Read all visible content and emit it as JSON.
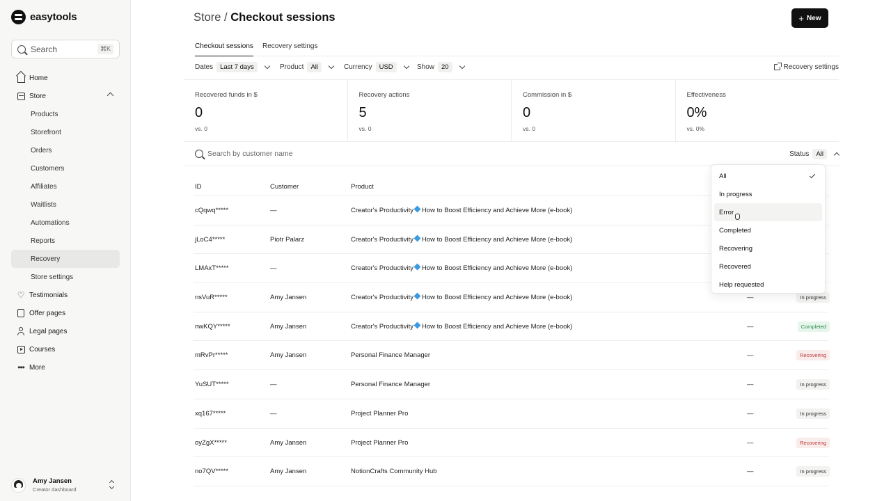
{
  "app": {
    "logo_text": "easytools"
  },
  "sidebar": {
    "search_label": "Search",
    "search_shortcut": "⌘K",
    "items": [
      {
        "label": "Home",
        "icon": "home-icon"
      },
      {
        "label": "Store",
        "icon": "store-icon",
        "expanded": true
      },
      {
        "label": "Products",
        "sub": true
      },
      {
        "label": "Storefront",
        "sub": true
      },
      {
        "label": "Orders",
        "sub": true
      },
      {
        "label": "Customers",
        "sub": true
      },
      {
        "label": "Affiliates",
        "sub": true
      },
      {
        "label": "Waitlists",
        "sub": true
      },
      {
        "label": "Automations",
        "sub": true
      },
      {
        "label": "Reports",
        "sub": true
      },
      {
        "label": "Recovery",
        "sub": true,
        "active": true
      },
      {
        "label": "Store settings",
        "sub": true
      },
      {
        "label": "Testimonials",
        "icon": "heart-icon"
      },
      {
        "label": "Offer pages",
        "icon": "page-icon"
      },
      {
        "label": "Legal pages",
        "icon": "user-icon"
      },
      {
        "label": "Courses",
        "icon": "play-icon"
      },
      {
        "label": "More",
        "icon": "more-icon"
      }
    ],
    "profile": {
      "name": "Amy Jansen",
      "subtitle": "Creator dashboard"
    }
  },
  "header": {
    "crumb": "Store",
    "separator": " / ",
    "title": "Checkout sessions",
    "new_button": "New"
  },
  "tabs": [
    {
      "label": "Checkout sessions",
      "active": true
    },
    {
      "label": "Recovery settings",
      "active": false
    }
  ],
  "filters": {
    "dates_label": "Dates",
    "dates_value": "Last 7 days",
    "product_label": "Product",
    "product_value": "All",
    "currency_label": "Currency",
    "currency_value": "USD",
    "show_label": "Show",
    "show_value": "20",
    "recovery_link": "Recovery settings"
  },
  "stats": [
    {
      "label": "Recovered funds in $",
      "value": "0",
      "sub": "vs. 0"
    },
    {
      "label": "Recovery actions",
      "value": "5",
      "sub": "vs. 0"
    },
    {
      "label": "Commission in $",
      "value": "0",
      "sub": "vs. 0"
    },
    {
      "label": "Effectiveness",
      "value": "0%",
      "sub": "vs. 0%"
    }
  ],
  "table_search": {
    "placeholder": "Search by customer name"
  },
  "status_filter": {
    "label": "Status",
    "value": "All"
  },
  "table": {
    "columns": [
      "ID",
      "Customer",
      "Product"
    ],
    "rows": [
      {
        "id": "cQqwq*****",
        "customer": "—",
        "product_a": "Creator's Productivity",
        "product_b": "How to Boost Efficiency and Achieve More (e-book)",
        "dash": "",
        "status": ""
      },
      {
        "id": "jLoC4*****",
        "customer": "Piotr Palarz",
        "product_a": "Creator's Productivity",
        "product_b": "How to Boost Efficiency and Achieve More (e-book)",
        "dash": "",
        "status": ""
      },
      {
        "id": "LMAxT*****",
        "customer": "—",
        "product_a": "Creator's Productivity",
        "product_b": "How to Boost Efficiency and Achieve More (e-book)",
        "dash": "",
        "status": ""
      },
      {
        "id": "nsVuR*****",
        "customer": "Amy Jansen",
        "product_a": "Creator's Productivity",
        "product_b": "How to Boost Efficiency and Achieve More (e-book)",
        "dash": "—",
        "status": "In progress"
      },
      {
        "id": "nwKQY*****",
        "customer": "Amy Jansen",
        "product_a": "Creator's Productivity",
        "product_b": "How to Boost Efficiency and Achieve More (e-book)",
        "dash": "—",
        "status": "Completed"
      },
      {
        "id": "mRvPr*****",
        "customer": "Amy Jansen",
        "product_a": "Personal Finance Manager",
        "product_b": "",
        "dash": "—",
        "status": "Recovering"
      },
      {
        "id": "YuSUT*****",
        "customer": "—",
        "product_a": "Personal Finance Manager",
        "product_b": "",
        "dash": "—",
        "status": "In progress"
      },
      {
        "id": "xq167*****",
        "customer": "—",
        "product_a": "Project Planner Pro",
        "product_b": "",
        "dash": "—",
        "status": "In progress"
      },
      {
        "id": "oyZgX*****",
        "customer": "Amy Jansen",
        "product_a": "Project Planner Pro",
        "product_b": "",
        "dash": "—",
        "status": "Recovering"
      },
      {
        "id": "no7QV*****",
        "customer": "Amy Jansen",
        "product_a": "NotionCrafts Community Hub",
        "product_b": "",
        "dash": "—",
        "status": "In progress"
      }
    ]
  },
  "status_dropdown": {
    "options": [
      "All",
      "In progress",
      "Error",
      "Completed",
      "Recovering",
      "Recovered",
      "Help requested"
    ],
    "selected": "All",
    "hovered": "Error"
  },
  "colors": {
    "primary": "#111111",
    "completed": "#2f8a4d",
    "recovering": "#b83b3b",
    "gem": "#3b9be0"
  }
}
